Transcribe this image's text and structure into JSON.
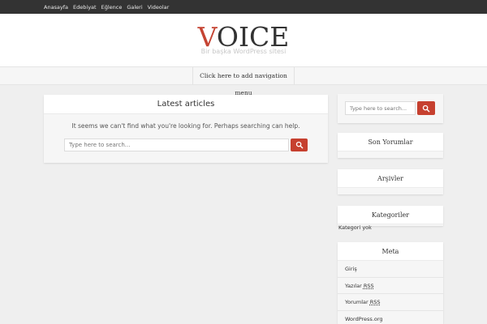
{
  "topbar": {
    "nav": [
      "Anasayfa",
      "Edebiyat",
      "Eğlence",
      "Galeri",
      "Videolar"
    ]
  },
  "header": {
    "logo_first": "V",
    "logo_rest": "OICE",
    "tagline": "Bir başka WordPress sitesi"
  },
  "navbar": {
    "link": "Click here to add navigation menu"
  },
  "main": {
    "title": "Latest articles",
    "message": "It seems we can't find what you're looking for. Perhaps searching can help.",
    "search_placeholder": "Type here to search..."
  },
  "sidebar": {
    "search_placeholder": "Type here to search...",
    "widgets": [
      "Son Yorumlar",
      "Arşivler",
      "Kategoriler"
    ],
    "kategoriler_text": "Kategori yok",
    "meta": {
      "title": "Meta",
      "items": [
        "Giriş",
        "Yazılar",
        "Yorumlar",
        "WordPress.org"
      ],
      "rss": "RSS"
    }
  },
  "colors": {
    "accent": "#c6402f",
    "topbar": "#333333"
  },
  "icons": {
    "search": "search-icon"
  }
}
